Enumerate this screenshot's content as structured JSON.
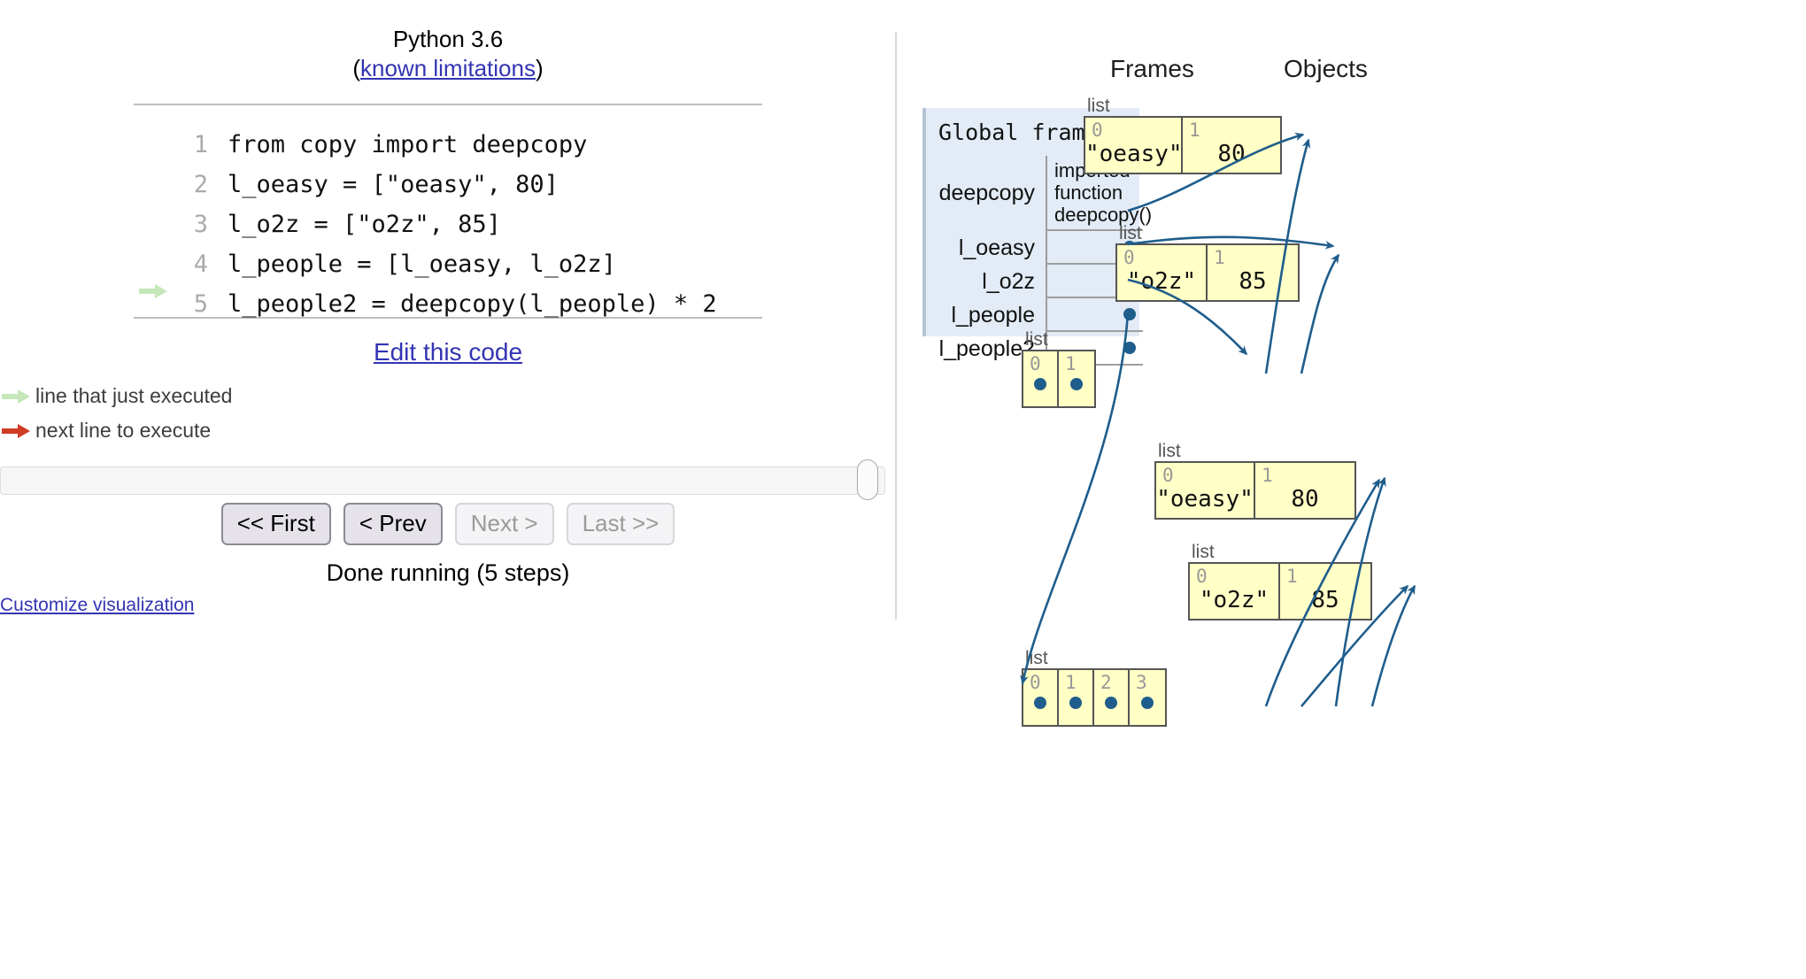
{
  "left": {
    "python_version": "Python 3.6",
    "limits_prefix": "(",
    "limits_link": "known limitations",
    "limits_suffix": ")",
    "code_lines": [
      {
        "num": "1",
        "text": "from copy import deepcopy",
        "marker": "none"
      },
      {
        "num": "2",
        "text": "l_oeasy = [\"oeasy\", 80]",
        "marker": "none"
      },
      {
        "num": "3",
        "text": "l_o2z = [\"o2z\", 85]",
        "marker": "none"
      },
      {
        "num": "4",
        "text": "l_people = [l_oeasy, l_o2z]",
        "marker": "none"
      },
      {
        "num": "5",
        "text": "l_people2 = deepcopy(l_people) * 2",
        "marker": "green"
      }
    ],
    "edit_link": "Edit this code",
    "legend": [
      {
        "icon": "green-arrow-icon",
        "label": "line that just executed"
      },
      {
        "icon": "red-arrow-icon",
        "label": "next line to execute"
      }
    ],
    "buttons": [
      {
        "label": "<< First",
        "enabled": true
      },
      {
        "label": "< Prev",
        "enabled": true
      },
      {
        "label": "Next >",
        "enabled": false
      },
      {
        "label": "Last >>",
        "enabled": false
      }
    ],
    "status": "Done running (5 steps)",
    "customize_link": "Customize visualization"
  },
  "right": {
    "frames_header": "Frames",
    "objects_header": "Objects",
    "frame": {
      "title": "Global frame",
      "vars": [
        {
          "name": "deepcopy",
          "value_text": "imported function deepcopy()",
          "has_pointer": false
        },
        {
          "name": "l_oeasy",
          "value_text": "",
          "has_pointer": true
        },
        {
          "name": "l_o2z",
          "value_text": "",
          "has_pointer": true
        },
        {
          "name": "l_people",
          "value_text": "",
          "has_pointer": true
        },
        {
          "name": "l_people2",
          "value_text": "",
          "has_pointer": true
        }
      ]
    },
    "objects": [
      {
        "id": "obj-oeasy-orig",
        "type_label": "list",
        "cells": [
          {
            "idx": "0",
            "value": "\"oeasy\""
          },
          {
            "idx": "1",
            "value": "80"
          }
        ]
      },
      {
        "id": "obj-o2z-orig",
        "type_label": "list",
        "cells": [
          {
            "idx": "0",
            "value": "\"o2z\""
          },
          {
            "idx": "1",
            "value": "85"
          }
        ]
      },
      {
        "id": "obj-people",
        "type_label": "list",
        "cells": [
          {
            "idx": "0",
            "value": ""
          },
          {
            "idx": "1",
            "value": ""
          }
        ]
      },
      {
        "id": "obj-oeasy-copy",
        "type_label": "list",
        "cells": [
          {
            "idx": "0",
            "value": "\"oeasy\""
          },
          {
            "idx": "1",
            "value": "80"
          }
        ]
      },
      {
        "id": "obj-o2z-copy",
        "type_label": "list",
        "cells": [
          {
            "idx": "0",
            "value": "\"o2z\""
          },
          {
            "idx": "1",
            "value": "85"
          }
        ]
      },
      {
        "id": "obj-people2",
        "type_label": "list",
        "cells": [
          {
            "idx": "0",
            "value": ""
          },
          {
            "idx": "1",
            "value": ""
          },
          {
            "idx": "2",
            "value": ""
          },
          {
            "idx": "3",
            "value": ""
          }
        ]
      }
    ]
  },
  "colors": {
    "link": "#3334b3",
    "frame_bg": "#e2ebf6",
    "object_bg": "#ffffc6",
    "object_border": "#555555",
    "pointer": "#1f5d8c",
    "green_arrow": "#c5e7b9",
    "red_arrow": "#d03c26"
  }
}
